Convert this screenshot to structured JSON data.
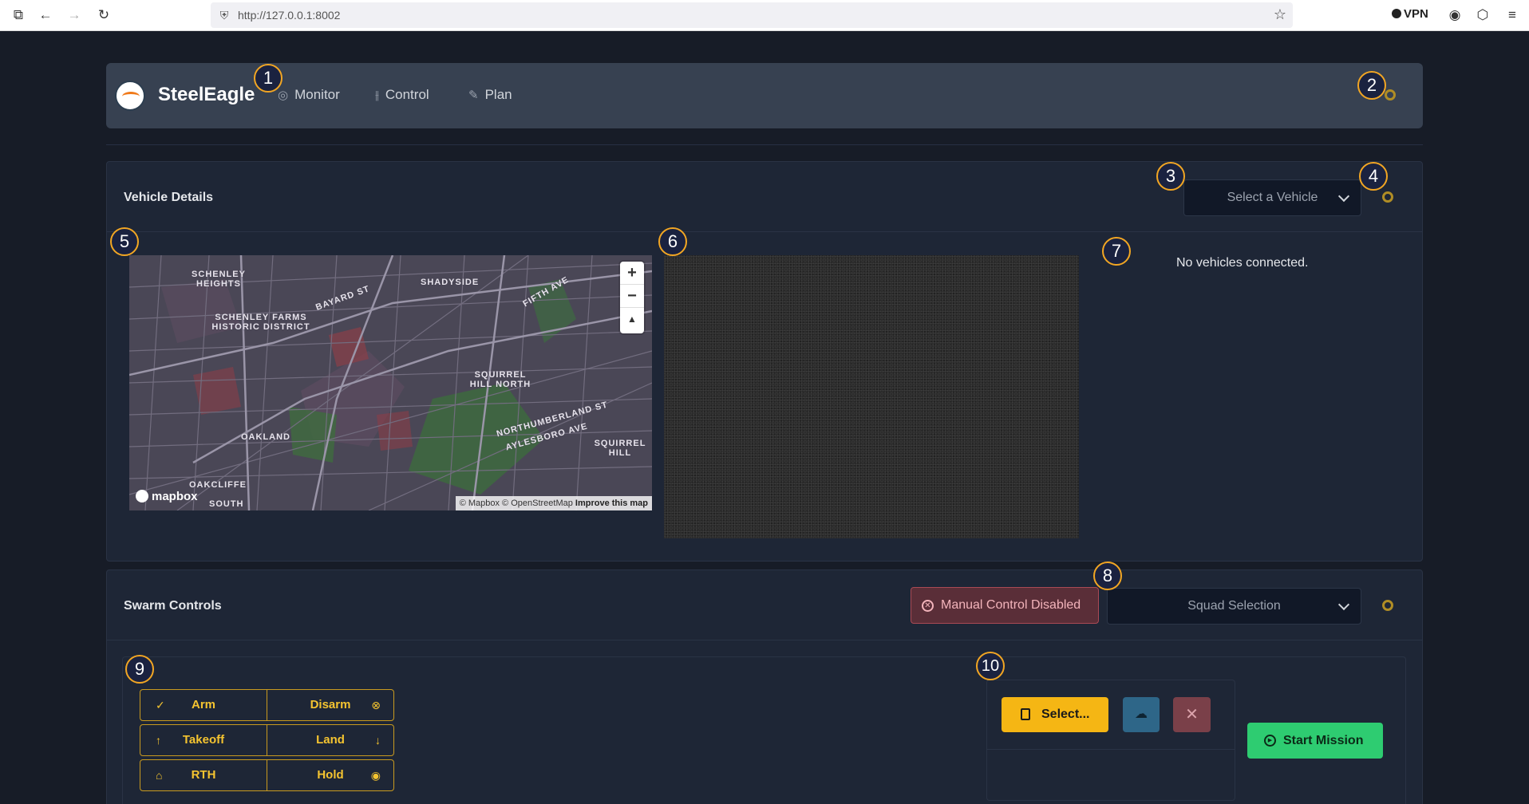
{
  "browser": {
    "url": "http://127.0.0.1:8002",
    "vpn_label": "VPN",
    "icons": [
      "tab-icon",
      "back-icon",
      "forward-icon",
      "reload-icon",
      "shield-icon",
      "star-icon",
      "account-icon",
      "extensions-icon",
      "menu-icon"
    ]
  },
  "callouts": [
    "1",
    "2",
    "3",
    "4",
    "5",
    "6",
    "7",
    "8",
    "9",
    "10"
  ],
  "header": {
    "brand": "SteelEagle",
    "nav": [
      {
        "label": "Monitor",
        "icon": "eye-icon"
      },
      {
        "label": "Control",
        "icon": "sliders-icon"
      },
      {
        "label": "Plan",
        "icon": "pencil-icon"
      }
    ]
  },
  "vehicle_details": {
    "title": "Vehicle Details",
    "select_placeholder": "Select a Vehicle",
    "status": "No vehicles connected."
  },
  "map": {
    "labels": [
      "SCHENLEY HEIGHTS",
      "SCHENLEY FARMS HISTORIC DISTRICT",
      "BAYARD ST",
      "SHADYSIDE",
      "FIFTH AVE",
      "SQUIRREL HILL NORTH",
      "NORTHUMBERLAND ST",
      "AYLESBORO AVE",
      "SQUIRREL HILL",
      "OAKLAND",
      "OAKCLIFFE",
      "SOUTH"
    ],
    "attribution": "© Mapbox © OpenStreetMap",
    "improve": "Improve this map",
    "logo_text": "mapbox"
  },
  "swarm": {
    "title": "Swarm Controls",
    "manual_status": "Manual Control Disabled",
    "squad_placeholder": "Squad Selection",
    "controls": [
      {
        "left": "Arm",
        "right": "Disarm",
        "left_icon": "check-circle-icon",
        "right_icon": "x-circle-icon"
      },
      {
        "left": "Takeoff",
        "right": "Land",
        "left_icon": "arrow-up-icon",
        "right_icon": "arrow-down-icon"
      },
      {
        "left": "RTH",
        "right": "Hold",
        "left_icon": "home-icon",
        "right_icon": "stop-circle-icon"
      }
    ],
    "select_button": "Select...",
    "start_button": "Start Mission"
  },
  "colors": {
    "accent": "#f5b614",
    "success": "#2ecc71",
    "danger": "#a94a55",
    "callout_ring": "#f2a623"
  }
}
